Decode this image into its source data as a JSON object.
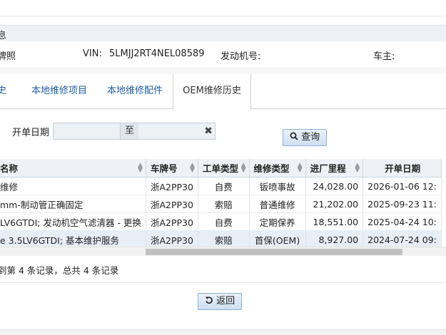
{
  "section": {
    "title": "息"
  },
  "vehicle": {
    "plate_label": "牌照",
    "vin_label": "VIN:",
    "vin_value": "5LMJJ2RT4NEL08589",
    "engine_label": "发动机号:",
    "owner_label": "车主:"
  },
  "tabs": [
    {
      "label": "史"
    },
    {
      "label": "本地维修项目"
    },
    {
      "label": "本地维修配件"
    },
    {
      "label": "OEM维修历史",
      "active": true
    }
  ],
  "search": {
    "open_date_label": "开单日期",
    "date_from": "",
    "date_separator": "至",
    "date_to": "",
    "query_button": "查询"
  },
  "table": {
    "columns": [
      "名称",
      "车牌号",
      "工单类型",
      "维修类型",
      "进厂里程",
      "开单日期"
    ],
    "rows": [
      [
        "维修",
        "浙A2PP30",
        "自费",
        "钣喷事故",
        "24,028.00",
        "2026-01-06 12:"
      ],
      [
        "mm-制动管正确固定",
        "浙A2PP30",
        "索赔",
        "普通维修",
        "21,202.00",
        "2025-09-23 11:"
      ],
      [
        "LV6GTDI; 发动机空气滤清器 - 更换",
        "浙A2PP30",
        "自费",
        "定期保养",
        "18,551.00",
        "2025-04-24 10:"
      ],
      [
        "e 3.5LV6GTDI; 基本维护服务",
        "浙A2PP30",
        "索赔",
        "首保(OEM)",
        "8,927.00",
        "2024-07-24 09:"
      ]
    ],
    "selected_row": 3
  },
  "pager": {
    "text": "到第 4 条记录，总共 4 条记录"
  },
  "footer": {
    "back_button": "返回"
  },
  "icons": {
    "clear": "close-icon",
    "search": "search-icon",
    "back": "undo-icon",
    "sort": "sort-icon"
  },
  "colors": {
    "link": "#1d5fa8",
    "header_bg": "#eef2f6",
    "button_bg": "#dbe7f5",
    "selected_row": "#e8eef6"
  }
}
